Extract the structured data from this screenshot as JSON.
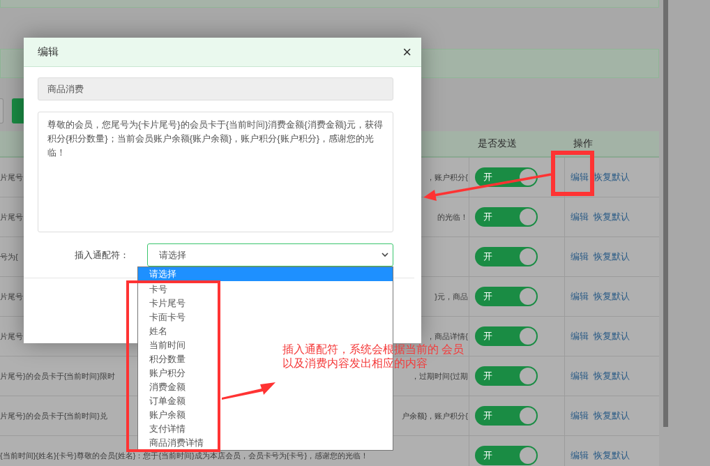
{
  "table": {
    "columns": [
      {
        "label": "是否发送"
      },
      {
        "label": "操作"
      }
    ],
    "rows": [
      {
        "content_left": "片尾号",
        "content_right": "，账户积分{",
        "on": true,
        "toggle_label": "开",
        "actions": [
          "编辑",
          "恢复默认"
        ]
      },
      {
        "content_left": "片尾号",
        "content_right": "的光临！",
        "on": true,
        "toggle_label": "开",
        "actions": [
          "编辑",
          "恢复默认"
        ]
      },
      {
        "content_left": "号为{",
        "content_right": "",
        "on": true,
        "toggle_label": "开",
        "actions": [
          "编辑",
          "恢复默认"
        ]
      },
      {
        "content_left": "片尾号",
        "content_right": "}元，商品",
        "on": true,
        "toggle_label": "开",
        "actions": [
          "编辑",
          "恢复默认"
        ]
      },
      {
        "content_left": "片尾号",
        "content_right": "，商品详情{",
        "on": true,
        "toggle_label": "开",
        "actions": [
          "编辑",
          "恢复默认"
        ]
      },
      {
        "content_left": "片尾号}的会员卡于{当前时间}限时",
        "content_right": "，过期时间{过期",
        "on": true,
        "toggle_label": "开",
        "actions": [
          "编辑",
          "恢复默认"
        ]
      },
      {
        "content_left": "片尾号}的会员卡于{当前时间}兑",
        "content_right": "户余额}，账户积分{",
        "on": true,
        "toggle_label": "开",
        "actions": [
          "编辑",
          "恢复默认"
        ]
      },
      {
        "content_left": "{当前时间}{姓名}{卡号}尊敬的会员{姓名}：您于{当前时间}成为本店会员，会员卡号为{卡号}，感谢您的光临！",
        "content_right": "",
        "on": true,
        "toggle_label": "开",
        "actions": [
          "编辑",
          "恢复默认"
        ]
      }
    ]
  },
  "modal": {
    "title": "编辑",
    "close": "×",
    "name_value": "商品消费",
    "template_value": "尊敬的会员，您尾号为{卡片尾号}的会员卡于{当前时间}消费金额{消费金额}元，获得积分{积分数量}；当前会员账户余额{账户余额}，账户积分{账户积分}，感谢您的光临！",
    "insert_label": "插入通配符：",
    "select_value": "请选择",
    "options": [
      {
        "label": "请选择",
        "selected": true
      },
      {
        "label": "卡号",
        "selected": false
      },
      {
        "label": "卡片尾号",
        "selected": false
      },
      {
        "label": "卡面卡号",
        "selected": false
      },
      {
        "label": "姓名",
        "selected": false
      },
      {
        "label": "当前时间",
        "selected": false
      },
      {
        "label": "积分数量",
        "selected": false
      },
      {
        "label": "账户积分",
        "selected": false
      },
      {
        "label": "消费金额",
        "selected": false
      },
      {
        "label": "订单金额",
        "selected": false
      },
      {
        "label": "账户余额",
        "selected": false
      },
      {
        "label": "支付详情",
        "selected": false
      },
      {
        "label": "商品消费详情",
        "selected": false
      }
    ]
  },
  "annotation": {
    "lines": [
      "插入通配符，系统会根据当前的 会员",
      "以及消费内容发出相应的内容"
    ]
  }
}
